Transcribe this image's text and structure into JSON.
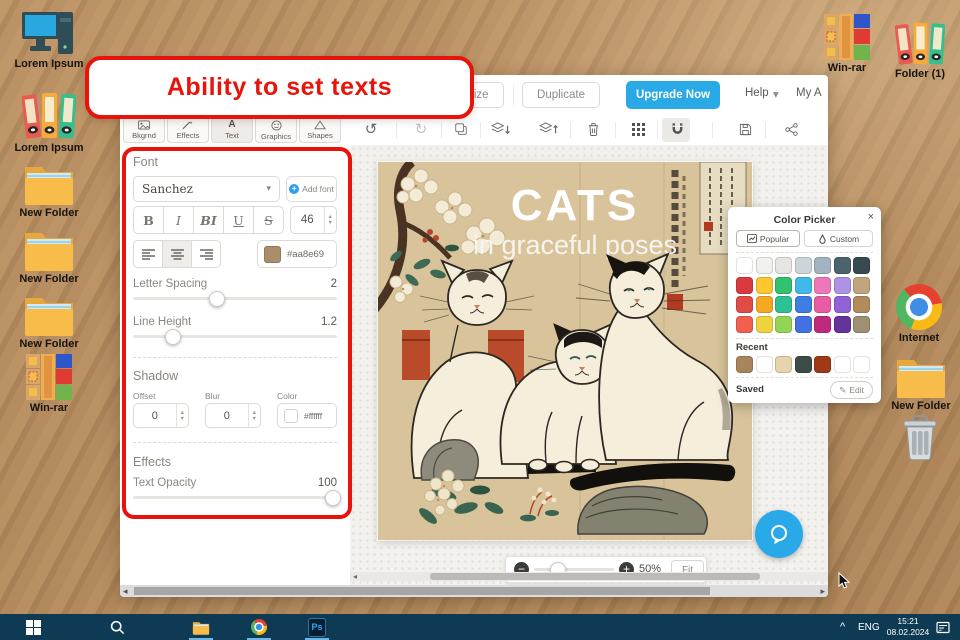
{
  "annotation": {
    "text": "Ability to set texts"
  },
  "icons": {
    "caret_down": "▾",
    "close": "×",
    "minus": "−",
    "plus": "+",
    "up": "▲",
    "down": "▼",
    "left_arrow": "◂",
    "right_arrow": "▸",
    "undo": "↺",
    "redo": "↻",
    "edit": "✎",
    "chevron_up": "^",
    "text_a": "A"
  },
  "desktop": {
    "left_icons": [
      {
        "label": "Lorem Ipsum"
      },
      {
        "label": "Lorem Ipsum"
      },
      {
        "label": "New Folder"
      },
      {
        "label": "New Folder"
      },
      {
        "label": "New Folder"
      },
      {
        "label": "Win-rar"
      }
    ],
    "right_icons": [
      {
        "label": "Win-rar"
      },
      {
        "label": "Folder (1)"
      },
      {
        "label": "Internet"
      },
      {
        "label": "New Folder"
      }
    ]
  },
  "app": {
    "topbar": {
      "resize": "Resize",
      "duplicate": "Duplicate",
      "upgrade": "Upgrade Now",
      "help": "Help",
      "account": "My A"
    },
    "tabs": [
      {
        "label": "Bkgrnd"
      },
      {
        "label": "Effects"
      },
      {
        "label": "Text"
      },
      {
        "label": "Graphics"
      },
      {
        "label": "Shapes"
      }
    ],
    "panel": {
      "font_title": "Font",
      "font_name": "Sanchez",
      "add_font": "Add font",
      "styles": [
        "B",
        "I",
        "BI",
        "U",
        "S"
      ],
      "font_size": "46",
      "color_hex": "#aa8e69",
      "ls_label": "Letter Spacing",
      "ls_value": "2",
      "lh_label": "Line Height",
      "lh_value": "1.2",
      "shadow_title": "Shadow",
      "offset_label": "Offset",
      "offset_value": "0",
      "blur_label": "Blur",
      "blur_value": "0",
      "color_label": "Color",
      "shadow_hex": "#ffffff",
      "effects_title": "Effects",
      "opacity_label": "Text Opacity",
      "opacity_value": "100"
    },
    "canvas": {
      "title": "CATS",
      "subtitle": "in graceful poses"
    },
    "zoombar": {
      "percent": "50%",
      "fit": "Fit"
    },
    "color_picker": {
      "title": "Color Picker",
      "popular": "Popular",
      "custom": "Custom",
      "recent_label": "Recent",
      "saved_label": "Saved",
      "edit_label": "Edit",
      "palette": [
        "#ffffff",
        "#f1f1ef",
        "#e5e5e3",
        "#cdd5da",
        "#a3b4c0",
        "#4b636d",
        "#364a50",
        "#d93a3f",
        "#fdc72f",
        "#33c16d",
        "#3fb9ea",
        "#ee77ba",
        "#ae92e3",
        "#c2a47d",
        "#e04b45",
        "#f7a823",
        "#2ec195",
        "#3e7de4",
        "#e95ba3",
        "#9161d6",
        "#b28a5b",
        "#f2604d",
        "#eed23e",
        "#92d553",
        "#4471e1",
        "#c02a7c",
        "#64349c",
        "#9e8f75"
      ],
      "recent": [
        "#a8845a",
        "#ffffff",
        "#e7d3ac",
        "#3d4b47",
        "#9e3a16",
        "#ffffff",
        "#ffffff"
      ]
    }
  },
  "taskbar": {
    "lang": "ENG",
    "time": "15:21",
    "date": "08.02.2024"
  }
}
